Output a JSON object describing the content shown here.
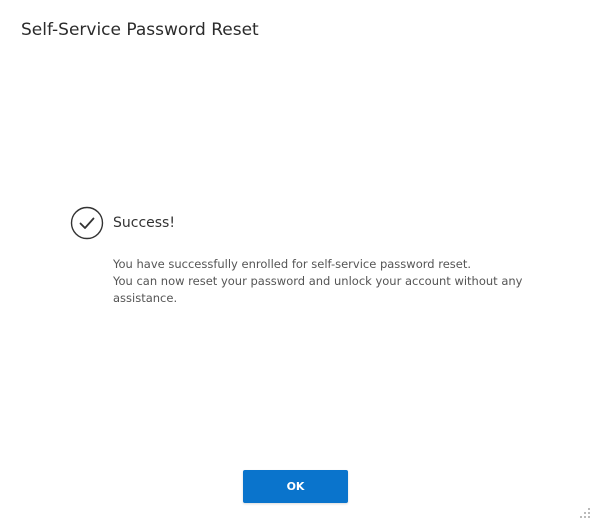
{
  "dialog": {
    "title": "Self-Service Password Reset"
  },
  "success": {
    "icon": "checkmark-circle-icon",
    "heading": "Success!",
    "message_line1": "You have successfully enrolled for self-service password reset.",
    "message_line2": "You can now reset your password and unlock your account without any assistance."
  },
  "footer": {
    "ok_label": "OK"
  },
  "colors": {
    "accent": "#0a74cc",
    "text": "#333333",
    "muted_text": "#555555",
    "background": "#ffffff"
  },
  "icons": {
    "resize_grip": "resize-grip-icon"
  }
}
